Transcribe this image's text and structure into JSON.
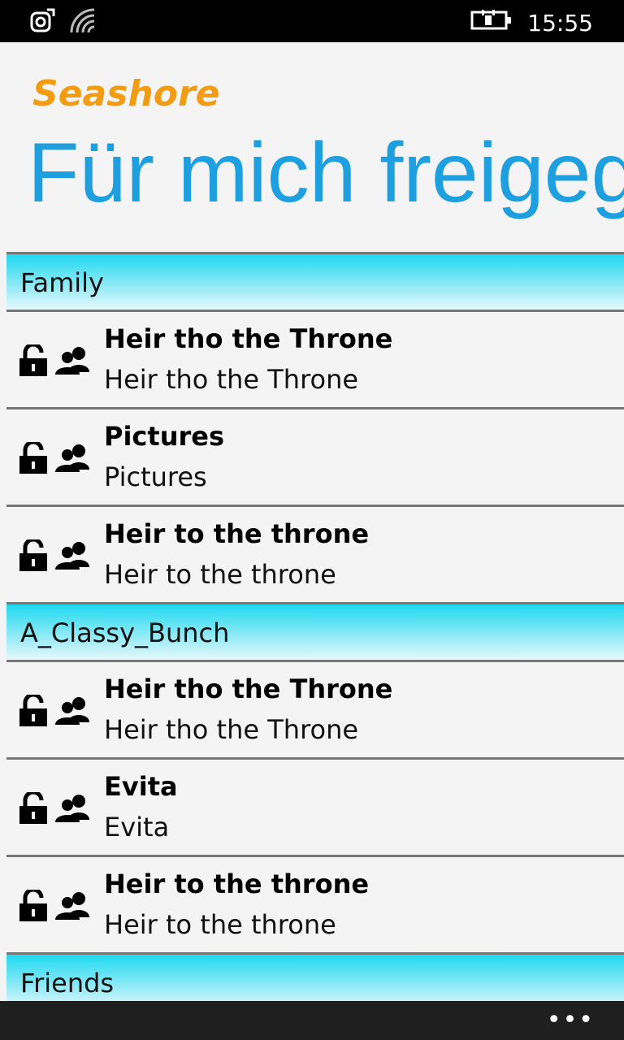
{
  "status_bar": {
    "time": "15:55",
    "icons": [
      "nfc-icon",
      "wifi-icon",
      "battery-charging-icon"
    ]
  },
  "header": {
    "app_name": "Seashore",
    "page_title": "Für mich freigegeben"
  },
  "groups": [
    {
      "name": "Family",
      "items": [
        {
          "title": "Heir tho the Throne",
          "subtitle": "Heir tho the Throne"
        },
        {
          "title": "Pictures",
          "subtitle": "Pictures"
        },
        {
          "title": "Heir to the throne",
          "subtitle": "Heir to the throne"
        }
      ]
    },
    {
      "name": "A_Classy_Bunch",
      "items": [
        {
          "title": "Heir tho the Throne",
          "subtitle": "Heir tho the Throne"
        },
        {
          "title": "Evita",
          "subtitle": "Evita"
        },
        {
          "title": "Heir to the throne",
          "subtitle": "Heir to the throne"
        }
      ]
    },
    {
      "name": "Friends",
      "items": []
    }
  ],
  "app_bar": {
    "more_label": "•••"
  },
  "colors": {
    "accent": "#1e9fe0",
    "brand": "#f39c12",
    "group_header_top": "#1ed8f0"
  }
}
